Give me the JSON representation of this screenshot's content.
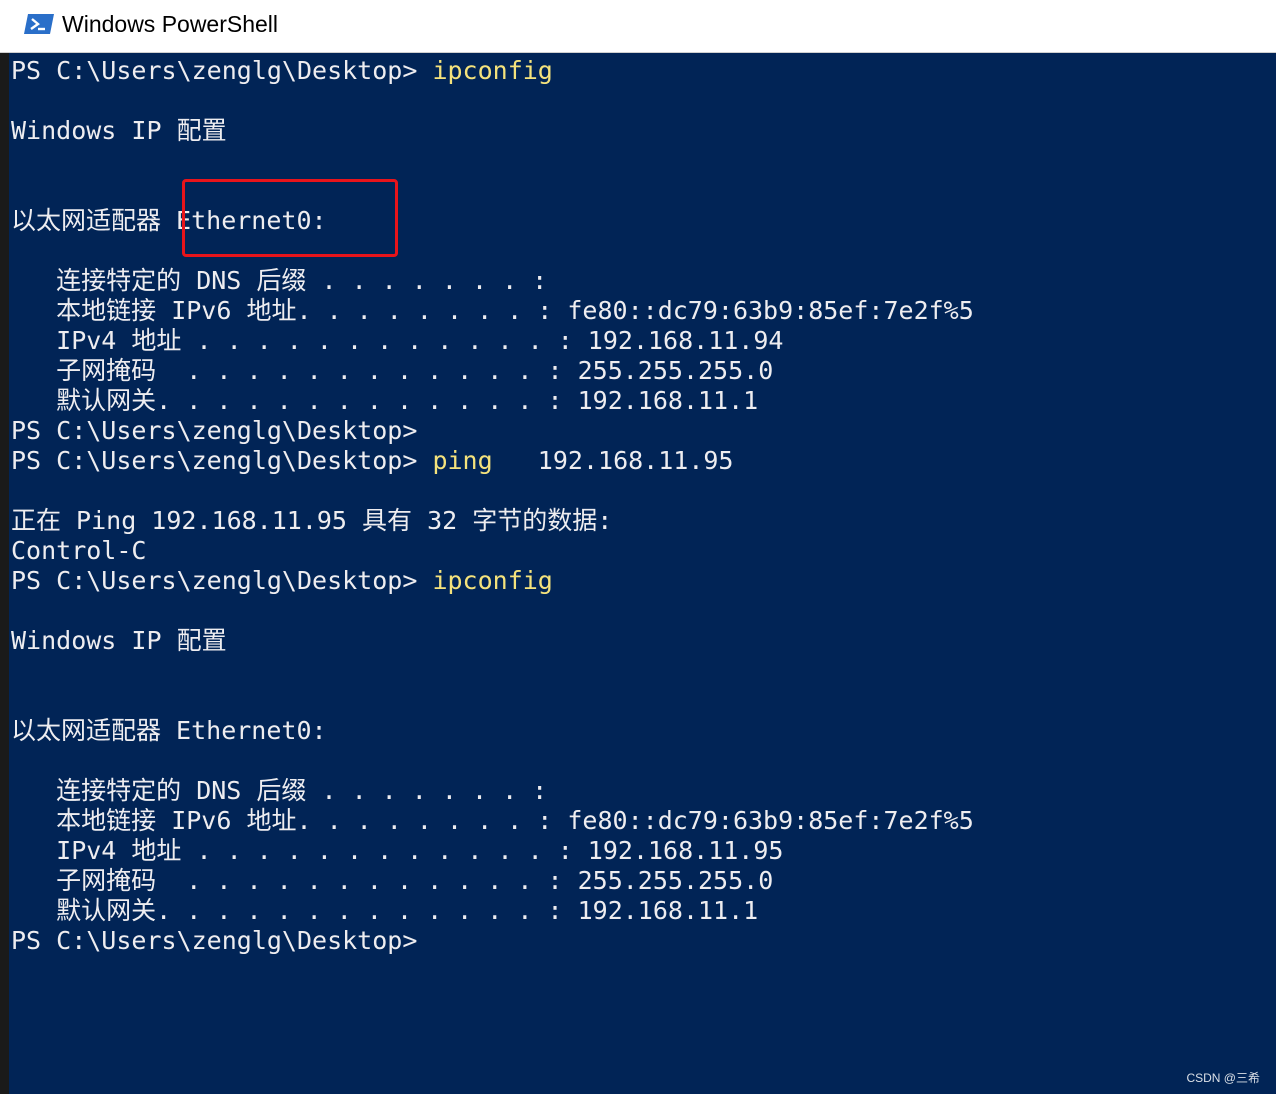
{
  "window": {
    "title": "Windows PowerShell",
    "icon": "powershell-icon"
  },
  "colors": {
    "console_bg": "#012456",
    "console_fg": "#eeedf0",
    "command": "#f4e27c",
    "highlight": "#e8141b"
  },
  "console": {
    "lines": [
      {
        "prompt": "PS C:\\Users\\zenglg\\Desktop> ",
        "command": "ipconfig"
      },
      {
        "text": ""
      },
      {
        "text": "Windows IP 配置"
      },
      {
        "text": ""
      },
      {
        "text": ""
      },
      {
        "text": "以太网适配器 Ethernet0:"
      },
      {
        "text": ""
      },
      {
        "text": "   连接特定的 DNS 后缀 . . . . . . . :"
      },
      {
        "text": "   本地链接 IPv6 地址. . . . . . . . : fe80::dc79:63b9:85ef:7e2f%5"
      },
      {
        "text": "   IPv4 地址 . . . . . . . . . . . . : 192.168.11.94"
      },
      {
        "text": "   子网掩码  . . . . . . . . . . . . : 255.255.255.0"
      },
      {
        "text": "   默认网关. . . . . . . . . . . . . : 192.168.11.1"
      },
      {
        "prompt": "PS C:\\Users\\zenglg\\Desktop>",
        "command": ""
      },
      {
        "prompt": "PS C:\\Users\\zenglg\\Desktop> ",
        "command": "ping",
        "args": "   192.168.11.95"
      },
      {
        "text": ""
      },
      {
        "text": "正在 Ping 192.168.11.95 具有 32 字节的数据:"
      },
      {
        "text": "Control-C"
      },
      {
        "prompt": "PS C:\\Users\\zenglg\\Desktop> ",
        "command": "ipconfig"
      },
      {
        "text": ""
      },
      {
        "text": "Windows IP 配置"
      },
      {
        "text": ""
      },
      {
        "text": ""
      },
      {
        "text": "以太网适配器 Ethernet0:"
      },
      {
        "text": ""
      },
      {
        "text": "   连接特定的 DNS 后缀 . . . . . . . :"
      },
      {
        "text": "   本地链接 IPv6 地址. . . . . . . . : fe80::dc79:63b9:85ef:7e2f%5"
      },
      {
        "text": "   IPv4 地址 . . . . . . . . . . . . : 192.168.11.95"
      },
      {
        "text": "   子网掩码  . . . . . . . . . . . . : 255.255.255.0"
      },
      {
        "text": "   默认网关. . . . . . . . . . . . . : 192.168.11.1"
      },
      {
        "prompt": "PS C:\\Users\\zenglg\\Desktop>",
        "command": ""
      }
    ]
  },
  "watermark": "CSDN @三希"
}
